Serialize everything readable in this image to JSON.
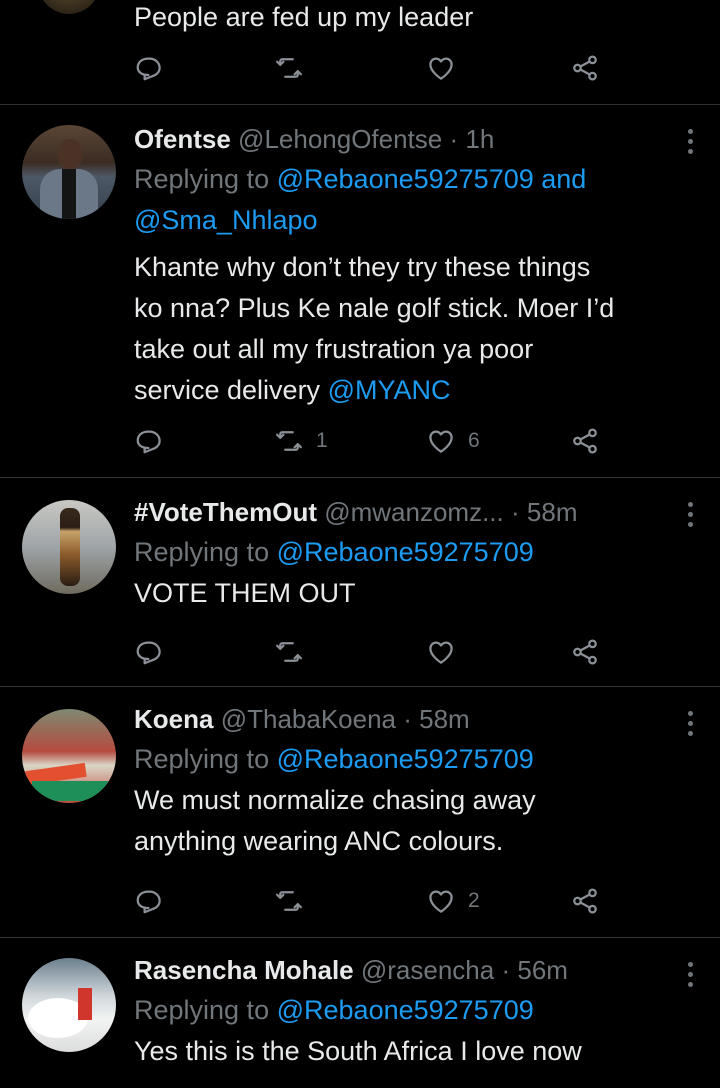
{
  "tweets": [
    {
      "partial": true,
      "body": "People are fed up my leader",
      "replies": "",
      "retweets": "",
      "likes": ""
    },
    {
      "display_name": "Ofentse",
      "handle": "@LehongOfentse",
      "time": "1h",
      "replying_prefix": "Replying to",
      "replying_to": "@Rebaone59275709",
      "replying_and": "and",
      "replying_to_2": "@Sma_Nhlapo",
      "body_lines": [
        "Khante why don’t they try these things",
        "ko nna? Plus Ke nale golf stick. Moer I’d",
        "take out all my frustration ya poor",
        "service delivery "
      ],
      "body_mention": "@MYANC",
      "retweets": "1",
      "likes": "6"
    },
    {
      "display_name": "#VoteThemOut",
      "handle": "@mwanzomz...",
      "time": "58m",
      "replying_prefix": "Replying to",
      "replying_to": "@Rebaone59275709",
      "body": "VOTE THEM OUT",
      "retweets": "",
      "likes": ""
    },
    {
      "display_name": "Koena",
      "handle": "@ThabaKoena",
      "time": "58m",
      "replying_prefix": "Replying to",
      "replying_to": "@Rebaone59275709",
      "body_lines": [
        "We must normalize chasing away",
        "anything wearing ANC colours."
      ],
      "retweets": "",
      "likes": "2"
    },
    {
      "display_name": "Rasencha Mohale",
      "handle": "@rasencha",
      "time": "56m",
      "replying_prefix": "Replying to",
      "replying_to": "@Rebaone59275709",
      "body": "Yes this is the South Africa I love now"
    }
  ],
  "separator": "·",
  "icons": {
    "reply": "reply-icon",
    "retweet": "retweet-icon",
    "like": "like-icon",
    "share": "share-icon",
    "more": "more-icon"
  },
  "colors": {
    "background": "#000000",
    "text": "#e7e9ea",
    "muted": "#71767b",
    "link": "#1d9bf0",
    "divider": "#2f3336"
  }
}
